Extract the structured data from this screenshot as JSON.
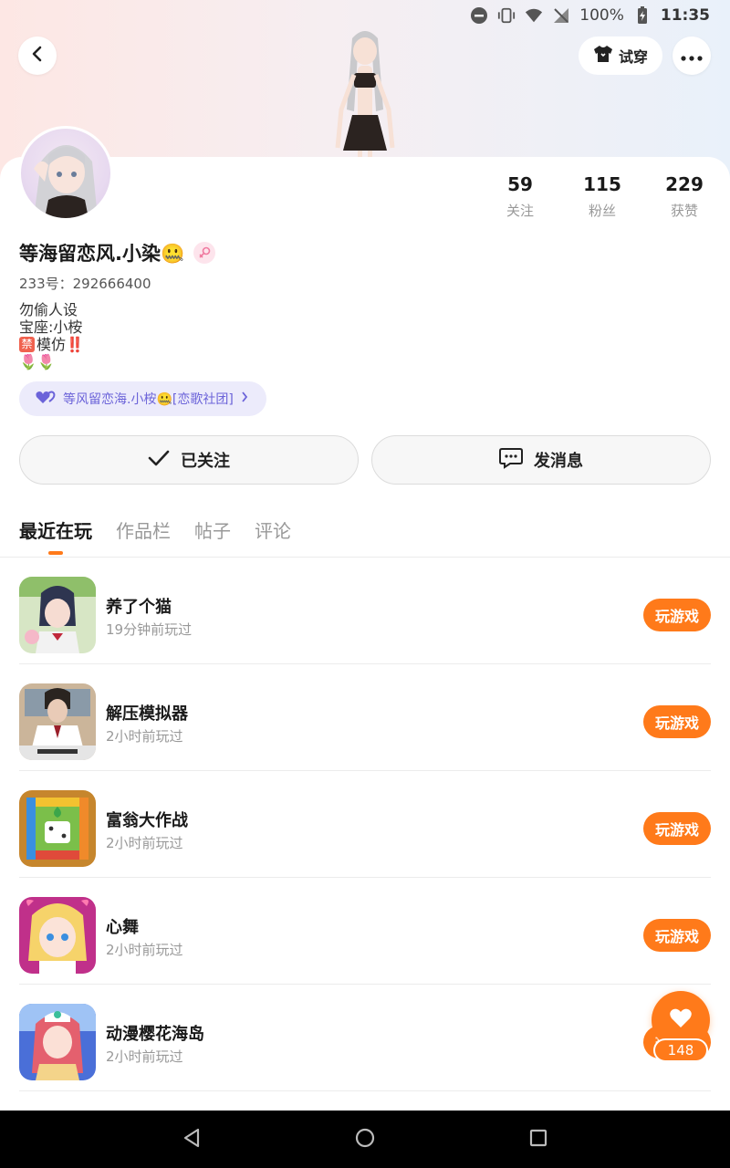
{
  "status_bar": {
    "battery": "100%",
    "time": "11:35"
  },
  "header": {
    "try_on_label": "试穿"
  },
  "profile": {
    "username": "等海留恋风.小染🤐",
    "uid": "233号：292666400",
    "bio": [
      "勿偷人设",
      "宝座:小桉",
      "模仿‼️",
      "🌷🌷"
    ],
    "ban_char": "禁",
    "club": "等风留恋海.小桉🤐[恋歌社团]"
  },
  "stats": [
    {
      "value": "59",
      "label": "关注"
    },
    {
      "value": "115",
      "label": "粉丝"
    },
    {
      "value": "229",
      "label": "获赞"
    }
  ],
  "actions": {
    "follow_label": "已关注",
    "message_label": "发消息"
  },
  "tabs": [
    "最近在玩",
    "作品栏",
    "帖子",
    "评论"
  ],
  "games": [
    {
      "name": "养了个猫",
      "time": "19分钟前玩过",
      "button": "玩游戏"
    },
    {
      "name": "解压模拟器",
      "time": "2小时前玩过",
      "button": "玩游戏"
    },
    {
      "name": "富翁大作战",
      "time": "2小时前玩过",
      "button": "玩游戏"
    },
    {
      "name": "心舞",
      "time": "2小时前玩过",
      "button": "玩游戏"
    },
    {
      "name": "动漫樱花海岛",
      "time": "2小时前玩过",
      "button": "玩游戏"
    }
  ],
  "like_count": "148",
  "colors": {
    "accent": "#ff7a1a",
    "club": "#6b63d9"
  }
}
